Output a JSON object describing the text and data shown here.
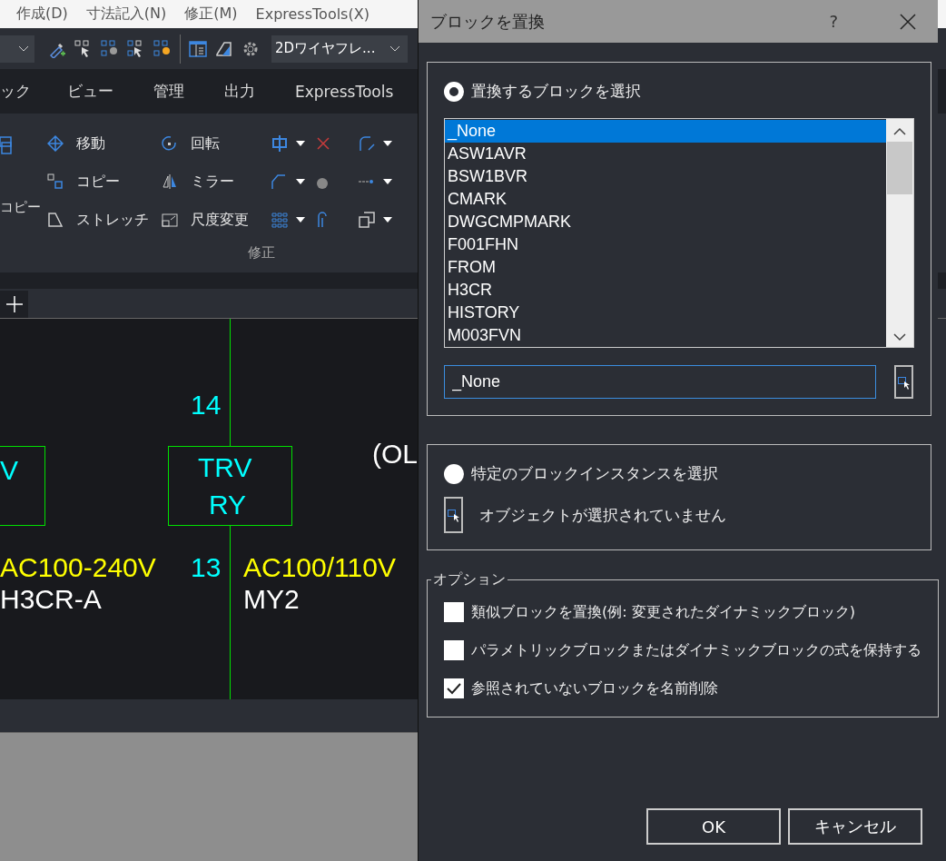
{
  "menu_bar": {
    "items": [
      "作成(D)",
      "寸法記入(N)",
      "修正(M)",
      "ExpressTools(X)"
    ]
  },
  "toolbar": {
    "visual_style": "2Dワイヤフレ..."
  },
  "ribbon": {
    "tabs": [
      "ック",
      "ビュー",
      "管理",
      "出力",
      "ExpressTools"
    ],
    "large_button": "コピー",
    "tools": [
      {
        "label": "移動",
        "kind": "move"
      },
      {
        "label": "コピー",
        "kind": "copy"
      },
      {
        "label": "ストレッチ",
        "kind": "stretch"
      },
      {
        "label": "回転",
        "kind": "rotate"
      },
      {
        "label": "ミラー",
        "kind": "mirror"
      },
      {
        "label": "尺度変更",
        "kind": "scale"
      }
    ],
    "panel_title": "修正"
  },
  "drawing": {
    "labels": [
      {
        "text": "14",
        "kind": "pin"
      },
      {
        "text": "(OL",
        "kind": "model"
      },
      {
        "text": "V",
        "kind": "device"
      },
      {
        "text": "TRV",
        "kind": "device"
      },
      {
        "text": "RY",
        "kind": "device"
      },
      {
        "text": "AC100-240V",
        "kind": "rating"
      },
      {
        "text": "13",
        "kind": "pin"
      },
      {
        "text": "AC100/110V",
        "kind": "rating"
      },
      {
        "text": "H3CR-A",
        "kind": "model"
      },
      {
        "text": "MY2",
        "kind": "model"
      }
    ]
  },
  "dialog": {
    "title": "ブロックを置換",
    "help": "?",
    "replace_source": {
      "label": "置換するブロックを選択",
      "selected": true
    },
    "block_list": [
      {
        "name": "_None",
        "selected": true
      },
      {
        "name": "ASW1AVR",
        "selected": false
      },
      {
        "name": "BSW1BVR",
        "selected": false
      },
      {
        "name": "CMARK",
        "selected": false
      },
      {
        "name": "DWGCMPMARK",
        "selected": false
      },
      {
        "name": "F001FHN",
        "selected": false
      },
      {
        "name": "FROM",
        "selected": false
      },
      {
        "name": "H3CR",
        "selected": false
      },
      {
        "name": "HISTORY",
        "selected": false
      },
      {
        "name": "M003FVN",
        "selected": false
      }
    ],
    "name_field": {
      "value": "_None"
    },
    "instance_source": {
      "label": "特定のブロックインスタンスを選択",
      "selected": false
    },
    "selection_status": "オブジェクトが選択されていません",
    "options": {
      "title": "オプション",
      "items": [
        {
          "label": "類似ブロックを置換(例: 変更されたダイナミックブロック)",
          "checked": false
        },
        {
          "label": "パラメトリックブロックまたはダイナミックブロックの式を保持する",
          "checked": false
        },
        {
          "label": "参照されていないブロックを名前削除",
          "checked": true
        }
      ]
    },
    "buttons": [
      "OK",
      "キャンセル"
    ]
  }
}
